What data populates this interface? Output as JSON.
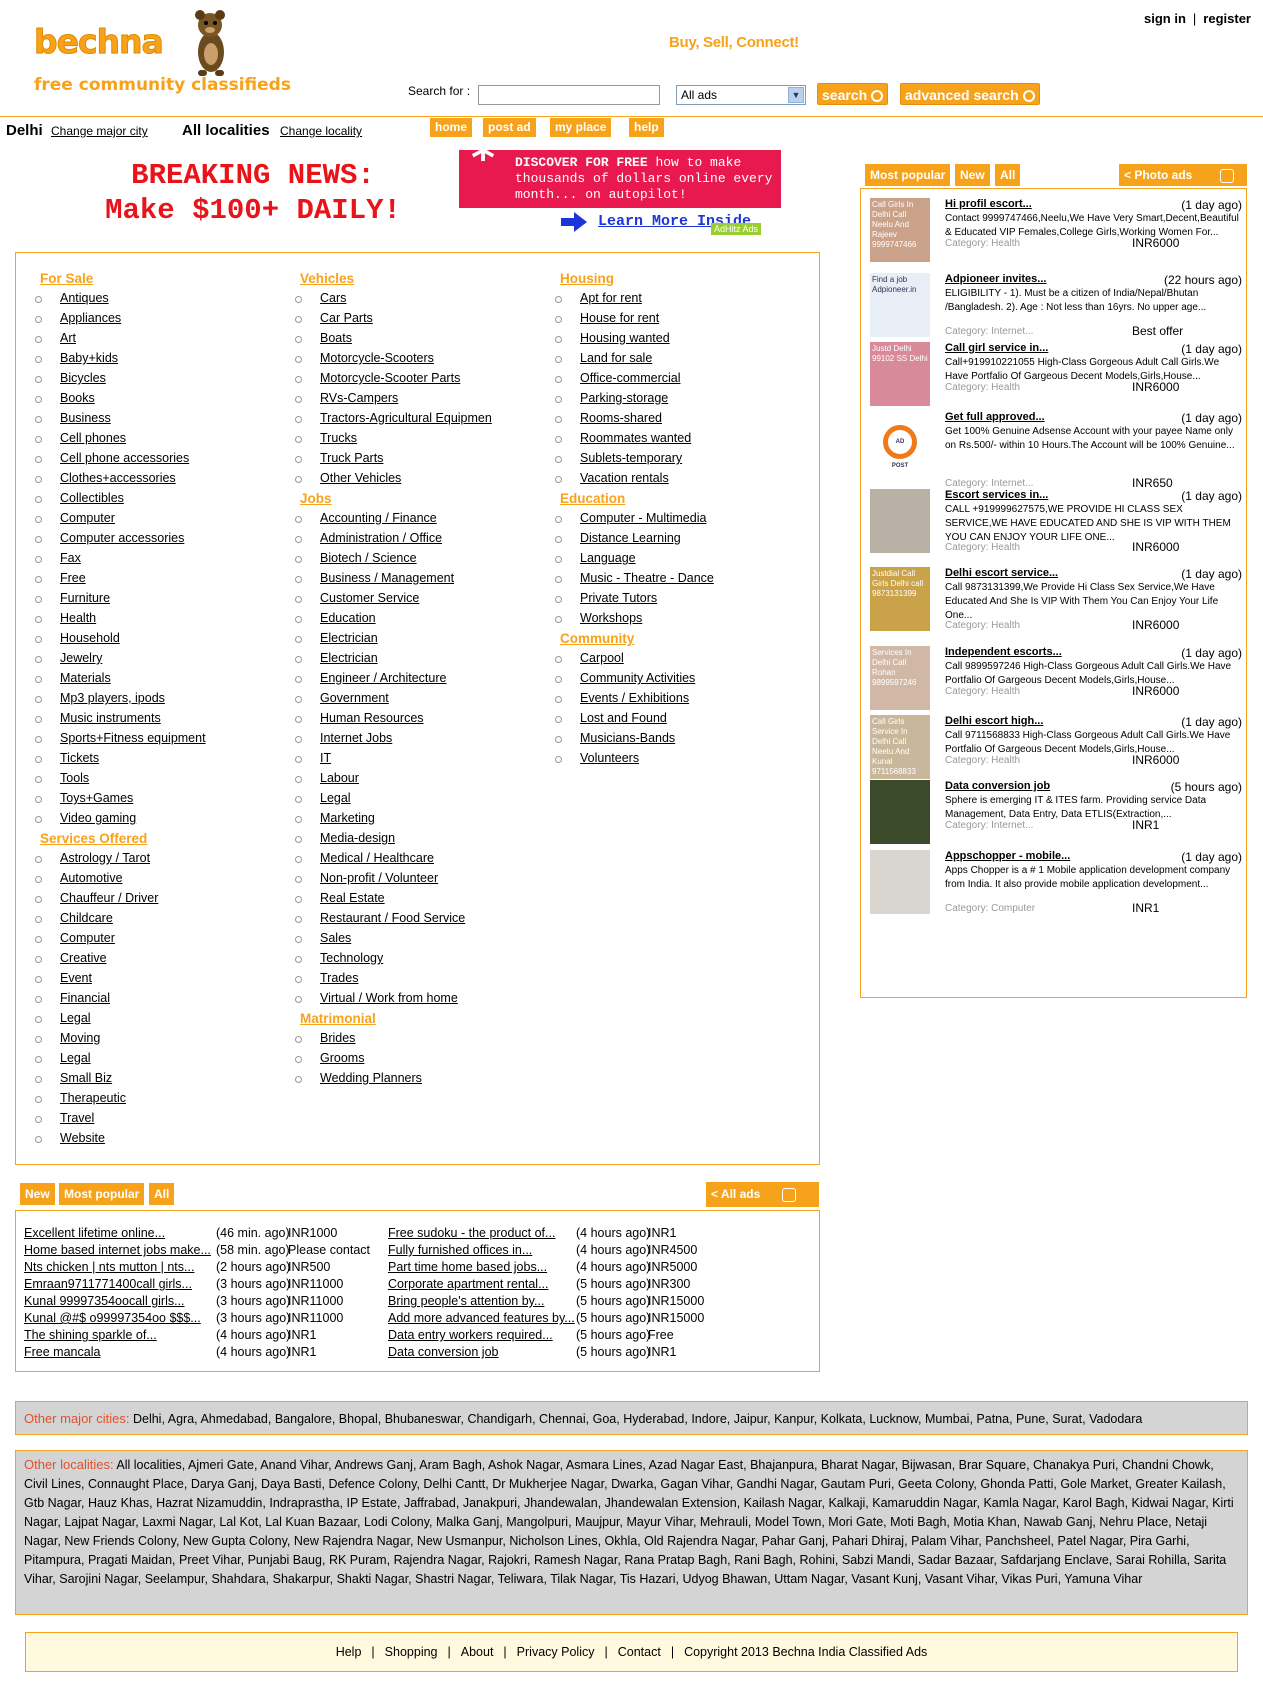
{
  "header": {
    "logo_text": "bechna",
    "logo_tagline": "free community classifieds",
    "sign_in": "sign in",
    "separator": "|",
    "register": "register",
    "slogan": "Buy, Sell, Connect!",
    "search_label": "Search for :",
    "search_value": "",
    "select_value": "All ads",
    "search_button": "search",
    "advanced_search_button": "advanced search"
  },
  "location": {
    "city": "Delhi",
    "change_city": "Change major city",
    "locality": "All localities",
    "change_locality": "Change locality"
  },
  "nav": [
    "home",
    "post ad",
    "my place",
    "help"
  ],
  "banner": {
    "breaking_line1": "BREAKING NEWS:",
    "breaking_line2": "Make $100+ DAILY!",
    "promo_star": "*",
    "promo_bold": "DISCOVER FOR FREE",
    "promo_rest": "how to make thousands of dollars online every month... on autopilot!",
    "learn_more": "Learn More Inside",
    "ad_network": "AdHitz Ads"
  },
  "categories": {
    "col1": [
      {
        "heading": "For Sale",
        "items": [
          "Antiques",
          "Appliances",
          "Art",
          "Baby+kids",
          "Bicycles",
          "Books",
          "Business",
          "Cell phones",
          "Cell phone accessories",
          "Clothes+accessories",
          "Collectibles",
          "Computer",
          "Computer accessories",
          "Fax",
          "Free",
          "Furniture",
          "Health",
          "Household",
          "Jewelry",
          "Materials",
          "Mp3 players, ipods",
          "Music instruments",
          "Sports+Fitness equipment",
          "Tickets",
          "Tools",
          "Toys+Games",
          "Video gaming"
        ]
      },
      {
        "heading": "Services Offered",
        "items": [
          "Astrology / Tarot",
          "Automotive",
          "Chauffeur / Driver",
          "Childcare",
          "Computer",
          "Creative",
          "Event",
          "Financial",
          "Legal",
          "Moving",
          "Legal",
          "Small Biz",
          "Therapeutic",
          "Travel",
          "Website"
        ]
      }
    ],
    "col2": [
      {
        "heading": "Vehicles",
        "items": [
          "Cars",
          "Car Parts",
          "Boats",
          "Motorcycle-Scooters",
          "Motorcycle-Scooter Parts",
          "RVs-Campers",
          "Tractors-Agricultural Equipmen",
          "Trucks",
          "Truck Parts",
          "Other Vehicles"
        ]
      },
      {
        "heading": "Jobs",
        "items": [
          "Accounting / Finance",
          "Administration / Office",
          "Biotech / Science",
          "Business / Management",
          "Customer Service",
          "Education",
          "Electrician",
          "Electrician",
          "Engineer / Architecture",
          "Government",
          "Human Resources",
          "Internet Jobs",
          "IT",
          "Labour",
          "Legal",
          "Marketing",
          "Media-design",
          "Medical / Healthcare",
          "Non-profit / Volunteer",
          "Real Estate",
          "Restaurant / Food Service",
          "Sales",
          "Technology",
          "Trades",
          "Virtual / Work from home"
        ]
      },
      {
        "heading": "Matrimonial",
        "items": [
          "Brides",
          "Grooms",
          "Wedding Planners"
        ]
      }
    ],
    "col3": [
      {
        "heading": "Housing",
        "items": [
          "Apt for rent",
          "House for rent",
          "Housing wanted",
          "Land for sale",
          "Office-commercial",
          "Parking-storage",
          "Rooms-shared",
          "Roommates wanted",
          "Sublets-temporary",
          "Vacation rentals"
        ]
      },
      {
        "heading": "Education",
        "items": [
          "Computer - Multimedia",
          "Distance Learning",
          "Language",
          "Music - Theatre - Dance",
          "Private Tutors",
          "Workshops"
        ]
      },
      {
        "heading": "Community",
        "items": [
          "Carpool",
          "Community Activities",
          "Events / Exhibitions",
          "Lost and Found",
          "Musicians-Bands",
          "Volunteers"
        ]
      }
    ]
  },
  "sidebar": {
    "tabs": [
      "Most popular",
      "New",
      "All"
    ],
    "photo_ads": "< Photo ads",
    "ads": [
      {
        "title": "Hi profil escort...",
        "age": "(1 day ago)",
        "desc": "Contact 9999747466,Neelu,We Have Very Smart,Decent,Beautiful & Educated VIP Females,College Girls,Working Women For...",
        "category": "Category: Health",
        "price": "INR6000",
        "thumb_text": "Call Girls In Delhi Call Neelu And Rajeev 9999747466"
      },
      {
        "title": "Adpioneer invites...",
        "age": "(22 hours ago)",
        "desc": "ELIGIBILITY - 1). Must be a citizen of India/Nepal/Bhutan /Bangladesh. 2). Age : Not less than 16yrs. No upper age...",
        "category": "Category: Internet...",
        "price": "Best offer",
        "thumb_text": "Find a job Adpioneer.in"
      },
      {
        "title": "Call girl service in...",
        "age": "(1 day ago)",
        "desc": "Call+919910221055 High-Class Gorgeous Adult Call Girls.We Have Portfalio Of Gargeous Decent Models,Girls,House...",
        "category": "Category: Health",
        "price": "INR6000",
        "thumb_text": "Justd Delhi 99102 SS Delhi"
      },
      {
        "title": "Get full approved...",
        "age": "(1 day ago)",
        "desc": "Get 100% Genuine Adsense Account with your payee Name only on Rs.500/- within 10 Hours.The Account will be 100% Genuine...",
        "category": "Category: Internet...",
        "price": "INR650",
        "thumb_text": "AD POST"
      },
      {
        "title": "Escort services in...",
        "age": "(1 day ago)",
        "desc": "CALL +919999627575,WE PROVIDE HI CLASS SEX SERVICE,WE HAVE EDUCATED AND SHE IS VIP WITH THEM YOU CAN ENJOY YOUR LIFE ONE...",
        "category": "Category: Health",
        "price": "INR6000",
        "thumb_text": ""
      },
      {
        "title": "Delhi escort service...",
        "age": "(1 day ago)",
        "desc": "Call 9873131399,We Provide Hi Class Sex Service,We Have Educated And She Is VIP With Them You Can Enjoy Your Life One...",
        "category": "Category: Health",
        "price": "INR6000",
        "thumb_text": "Justdial Call Girls Delhi call 9873131399"
      },
      {
        "title": "Independent escorts...",
        "age": "(1 day ago)",
        "desc": "Call 9899597246 High-Class Gorgeous Adult Call Girls.We Have Portfalio Of Gargeous Decent Models,Girls,House...",
        "category": "Category: Health",
        "price": "INR6000",
        "thumb_text": "Services In Delhi Call Rohan 9899597246"
      },
      {
        "title": "Delhi escort high...",
        "age": "(1 day ago)",
        "desc": "Call 9711568833 High-Class Gorgeous Adult Call Girls.We Have Portfalio Of Gargeous Decent Models,Girls,House...",
        "category": "Category: Health",
        "price": "INR6000",
        "thumb_text": "Call Girls Service In Delhi Call Neetu And Kunal 9711568833"
      },
      {
        "title": "Data conversion job",
        "age": "(5 hours ago)",
        "desc": "Sphere is emerging IT & ITES farm. Providing service Data Management, Data Entry, Data ETLIS(Extraction,...",
        "category": "Category: Internet...",
        "price": "INR1",
        "thumb_text": ""
      },
      {
        "title": "Appschopper - mobile...",
        "age": "(1 day ago)",
        "desc": "Apps Chopper is a # 1 Mobile application development company from India. It also provide mobile application development...",
        "category": "Category: Computer",
        "price": "INR1",
        "thumb_text": ""
      }
    ]
  },
  "latest": {
    "tabs": [
      "New",
      "Most popular",
      "All"
    ],
    "all_ads": "< All ads",
    "left": [
      {
        "title": "Excellent lifetime online...",
        "age": "(46 min. ago)",
        "price": "INR1000"
      },
      {
        "title": "Home based internet jobs make...",
        "age": "(58 min. ago)",
        "price": "Please contact"
      },
      {
        "title": "Nts chicken | nts mutton | nts...",
        "age": "(2 hours ago)",
        "price": "INR500"
      },
      {
        "title": "Emraan9711771400call girls...",
        "age": "(3 hours ago)",
        "price": "INR11000"
      },
      {
        "title": "Kunal 99997354oocall girls...",
        "age": "(3 hours ago)",
        "price": "INR11000"
      },
      {
        "title": "Kunal @#$ o99997354oo $$$...",
        "age": "(3 hours ago)",
        "price": "INR11000"
      },
      {
        "title": "The shining sparkle of...",
        "age": "(4 hours ago)",
        "price": "INR1"
      },
      {
        "title": "Free mancala",
        "age": "(4 hours ago)",
        "price": "INR1"
      }
    ],
    "right": [
      {
        "title": "Free sudoku - the product of...",
        "age": "(4 hours ago)",
        "price": "INR1"
      },
      {
        "title": "Fully furnished offices in...",
        "age": "(4 hours ago)",
        "price": "INR4500"
      },
      {
        "title": "Part time home based jobs...",
        "age": "(4 hours ago)",
        "price": "INR5000"
      },
      {
        "title": "Corporate apartment rental...",
        "age": "(5 hours ago)",
        "price": "INR300"
      },
      {
        "title": "Bring people's attention by...",
        "age": "(5 hours ago)",
        "price": "INR15000"
      },
      {
        "title": "Add more advanced features by...",
        "age": "(5 hours ago)",
        "price": "INR15000"
      },
      {
        "title": "Data entry workers required...",
        "age": "(5 hours ago)",
        "price": "Free"
      },
      {
        "title": "Data conversion job",
        "age": "(5 hours ago)",
        "price": "INR1"
      }
    ]
  },
  "other_cities": {
    "label": "Other major cities:",
    "items": [
      "Delhi",
      "Agra",
      "Ahmedabad",
      "Bangalore",
      "Bhopal",
      "Bhubaneswar",
      "Chandigarh",
      "Chennai",
      "Goa",
      "Hyderabad",
      "Indore",
      "Jaipur",
      "Kanpur",
      "Kolkata",
      "Lucknow",
      "Mumbai",
      "Patna",
      "Pune",
      "Surat",
      "Vadodara"
    ]
  },
  "other_localities": {
    "label": "Other localities:",
    "items": [
      "All localities",
      "Ajmeri Gate",
      "Anand Vihar",
      "Andrews Ganj",
      "Aram Bagh",
      "Ashok Nagar",
      "Asmara Lines",
      "Azad Nagar East",
      "Bhajanpura",
      "Bharat Nagar",
      "Bijwasan",
      "Brar Square",
      "Chanakya Puri",
      "Chandni Chowk",
      "Civil Lines",
      "Connaught Place",
      "Darya Ganj",
      "Daya Basti",
      "Defence Colony",
      "Delhi Cantt",
      "Dr Mukherjee Nagar",
      "Dwarka",
      "Gagan Vihar",
      "Gandhi Nagar",
      "Gautam Puri",
      "Geeta Colony",
      "Ghonda Patti",
      "Gole Market",
      "Greater Kailash",
      "Gtb Nagar",
      "Hauz Khas",
      "Hazrat Nizamuddin",
      "Indraprastha",
      "IP Estate",
      "Jaffrabad",
      "Janakpuri",
      "Jhandewalan",
      "Jhandewalan Extension",
      "Kailash Nagar",
      "Kalkaji",
      "Kamaruddin Nagar",
      "Kamla Nagar",
      "Karol Bagh",
      "Kidwai Nagar",
      "Kirti Nagar",
      "Lajpat Nagar",
      "Laxmi Nagar",
      "Lal Kot",
      "Lal Kuan Bazaar",
      "Lodi Colony",
      "Malka Ganj",
      "Mangolpuri",
      "Maujpur",
      "Mayur Vihar",
      "Mehrauli",
      "Model Town",
      "Mori Gate",
      "Moti Bagh",
      "Motia Khan",
      "Nawab Ganj",
      "Nehru Place",
      "Netaji Nagar",
      "New Friends Colony",
      "New Gupta Colony",
      "New Rajendra Nagar",
      "New Usmanpur",
      "Nicholson Lines",
      "Okhla",
      "Old Rajendra Nagar",
      "Pahar Ganj",
      "Pahari Dhiraj",
      "Palam Vihar",
      "Panchsheel",
      "Patel Nagar",
      "Pira Garhi",
      "Pitampura",
      "Pragati Maidan",
      "Preet Vihar",
      "Punjabi Baug",
      "RK Puram",
      "Rajendra Nagar",
      "Rajokri",
      "Ramesh Nagar",
      "Rana Pratap Bagh",
      "Rani Bagh",
      "Rohini",
      "Sabzi Mandi",
      "Sadar Bazaar",
      "Safdarjang Enclave",
      "Sarai Rohilla",
      "Sarita Vihar",
      "Sarojini Nagar",
      "Seelampur",
      "Shahdara",
      "Shakarpur",
      "Shakti Nagar",
      "Shastri Nagar",
      "Teliwara",
      "Tilak Nagar",
      "Tis Hazari",
      "Udyog Bhawan",
      "Uttam Nagar",
      "Vasant Kunj",
      "Vasant Vihar",
      "Vikas Puri",
      "Yamuna Vihar"
    ]
  },
  "footer": {
    "links": [
      "Help",
      "Shopping",
      "About",
      "Privacy Policy",
      "Contact"
    ],
    "copyright": "Copyright 2013 Bechna India Classified Ads"
  },
  "colors": {
    "accent": "#f7a21b",
    "label_red": "#e3512b",
    "grey_box": "#d4d4d4"
  }
}
